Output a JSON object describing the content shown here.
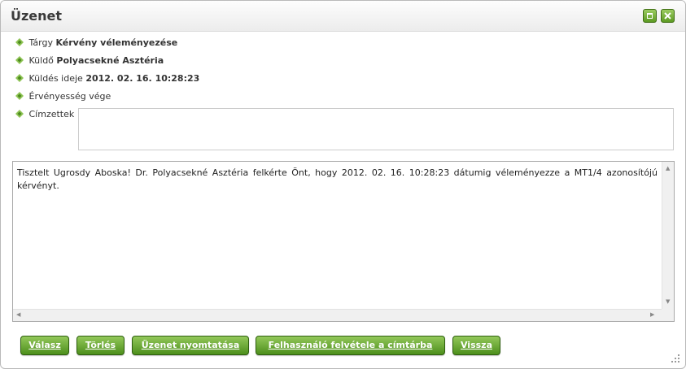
{
  "window": {
    "title": "Üzenet"
  },
  "fields": {
    "subject": {
      "label": "Tárgy",
      "value": "Kérvény véleményezése"
    },
    "sender": {
      "label": "Küldő",
      "value": "Polyacsekné Asztéria"
    },
    "sent_at": {
      "label": "Küldés ideje",
      "value": "2012. 02. 16. 10:28:23"
    },
    "validity": {
      "label": "Érvényesség vége",
      "value": ""
    },
    "recipients": {
      "label": "Címzettek",
      "value": ""
    }
  },
  "message": {
    "body": "Tisztelt Ugrosdy Aboska! Dr. Polyacsekné Asztéria felkérte Önt, hogy 2012. 02. 16. 10:28:23 dátumig véleményezze a MT1/4 azonosítójú kérvényt."
  },
  "buttons": {
    "reply": "Válasz",
    "delete": "Törlés",
    "print": "Üzenet nyomtatása",
    "add_contact": "Felhasználó felvétele a címtárba",
    "back": "Vissza"
  },
  "icons": {
    "maximize": "maximize-icon",
    "close": "close-icon",
    "bullet": "diamond-bullet-icon",
    "resize": "resize-grip-icon"
  },
  "colors": {
    "button_green": "#5c9a22",
    "bullet_green": "#6aa32c"
  }
}
